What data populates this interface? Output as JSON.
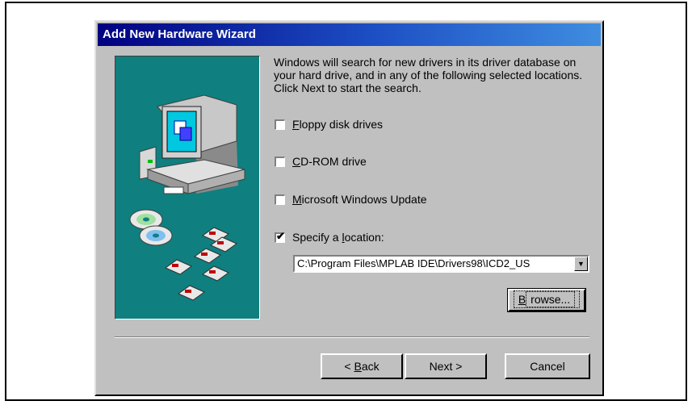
{
  "window": {
    "title": "Add New Hardware Wizard"
  },
  "instructions": "Windows will search for new drivers in its driver database on your hard drive, and in any of the following selected locations. Click Next to start the search.",
  "options": [
    {
      "pre": "",
      "key": "F",
      "post": "loppy disk drives",
      "checked": false
    },
    {
      "pre": "",
      "key": "C",
      "post": "D-ROM drive",
      "checked": false
    },
    {
      "pre": "",
      "key": "M",
      "post": "icrosoft Windows Update",
      "checked": false
    },
    {
      "pre": "Specify a ",
      "key": "l",
      "post": "ocation:",
      "checked": true
    }
  ],
  "location": {
    "value": "C:\\Program Files\\MPLAB IDE\\Drivers98\\ICD2_US"
  },
  "buttons": {
    "browse": {
      "key": "B",
      "rest": "rowse..."
    },
    "back": {
      "prefix": "< ",
      "key": "B",
      "rest": "ack"
    },
    "next": "Next >",
    "cancel": "Cancel"
  },
  "colors": {
    "title_start": "#000080",
    "title_end": "#3f8de0",
    "art_bg": "#0f7f7f",
    "face": "#c0c0c0"
  }
}
